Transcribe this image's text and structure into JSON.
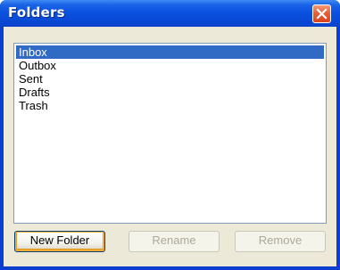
{
  "window": {
    "title": "Folders"
  },
  "folders": {
    "items": [
      "Inbox",
      "Outbox",
      "Sent",
      "Drafts",
      "Trash"
    ],
    "selected": "Inbox"
  },
  "buttons": {
    "new_folder": "New Folder",
    "rename": "Rename",
    "remove": "Remove"
  },
  "icons": {
    "close": "close-icon"
  },
  "colors": {
    "titlebar": "#0a52e0",
    "selection": "#316ac5",
    "client_bg": "#ece9d8",
    "close_button": "#e05a30"
  }
}
